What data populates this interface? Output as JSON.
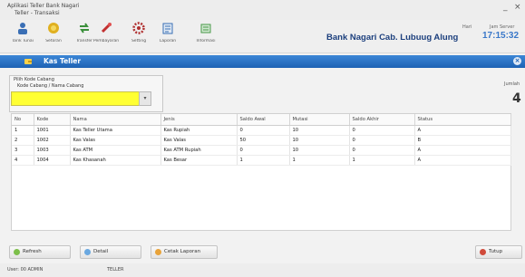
{
  "window": {
    "title_line1": "Aplikasi Teller Bank Nagari",
    "title_line2": "Teller - Transaksi",
    "controls": [
      "_",
      "×"
    ]
  },
  "toolbar": {
    "items": [
      {
        "label": "Tarik Tunai",
        "icon": "cashier-icon",
        "color": "#3a6fb5"
      },
      {
        "label": "Setoran",
        "icon": "coin-icon",
        "color": "#e0b020"
      },
      {
        "label": "Transfer",
        "icon": "transfer-icon",
        "color": "#3a8f3a"
      },
      {
        "label": "Pembayaran",
        "icon": "payment-icon",
        "color": "#c23030"
      },
      {
        "label": "Setting",
        "icon": "gear-icon",
        "color": "#b03030"
      },
      {
        "label": "Laporan",
        "icon": "report-icon",
        "color": "#3a6fb5"
      },
      {
        "label": "Informasi",
        "icon": "info-icon",
        "color": "#4a9a4a"
      }
    ],
    "bank_name": "Bank Nagari Cab. Lubuug Alung",
    "label_left": "Hari",
    "label_right": "Jam Server",
    "clock": "17:15:32"
  },
  "panel": {
    "title": "Kas Teller",
    "close": "×"
  },
  "filter": {
    "label": "Pilih Kode Cabang",
    "sublabel": "Kode Cabang / Nama Cabang",
    "combo_value": "",
    "combo_button": "▾"
  },
  "count": {
    "label": "Jumlah",
    "value": "4"
  },
  "table": {
    "columns": [
      "No",
      "Kode",
      "Nama",
      "Jenis",
      "Saldo Awal",
      "Mutasi",
      "Saldo Akhir",
      "Status"
    ],
    "rows": [
      [
        "1",
        "1001",
        "Kas Teller Utama",
        "Kas Rupiah",
        "0",
        "10",
        "0",
        "A"
      ],
      [
        "2",
        "1002",
        "Kas Valas",
        "Kas Valas",
        "50",
        "10",
        "0",
        "B"
      ],
      [
        "3",
        "1003",
        "Kas ATM",
        "Kas ATM Rupiah",
        "0",
        "10",
        "0",
        "A"
      ],
      [
        "4",
        "1004",
        "Kas Khasanah",
        "Kas Besar",
        "1",
        "1",
        "1",
        "A"
      ]
    ]
  },
  "buttons": {
    "refresh": "Refresh",
    "detail": "Detail",
    "print": "Cetak Laporan",
    "close": "Tutup"
  },
  "status": {
    "user": "User: 00 ADMIN",
    "role": "TELLER"
  }
}
